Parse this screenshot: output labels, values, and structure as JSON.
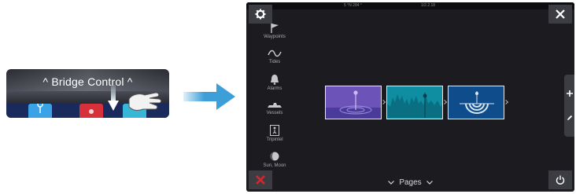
{
  "bridge_control": {
    "title": "Bridge Control",
    "arrow_left": "^",
    "arrow_right": "^"
  },
  "status_bar": {
    "left_text": "5 °N  284 °",
    "center_text": "1/2.2.18"
  },
  "sidebar": {
    "items": [
      {
        "label": "Waypoints",
        "icon": "flag-icon"
      },
      {
        "label": "Tides",
        "icon": "wave-icon"
      },
      {
        "label": "Alarms",
        "icon": "bell-icon"
      },
      {
        "label": "Vessels",
        "icon": "vessels-icon"
      },
      {
        "label": "Tripintel",
        "icon": "trip-icon"
      },
      {
        "label": "Sun, Moon",
        "icon": "moon-icon"
      }
    ]
  },
  "pages_bar": {
    "label": "Pages"
  },
  "page_tiles": [
    {
      "name": "chart-page",
      "color": "#6c53b7"
    },
    {
      "name": "echo-page",
      "color": "#0f8da1"
    },
    {
      "name": "sonar-page",
      "color": "#0e4c8c"
    }
  ],
  "colors": {
    "screen_bg": "#1c1c20",
    "button_bg": "#3c3d43",
    "alarm_red": "#d9252d",
    "arrow_blue": "#3d9fd8"
  }
}
